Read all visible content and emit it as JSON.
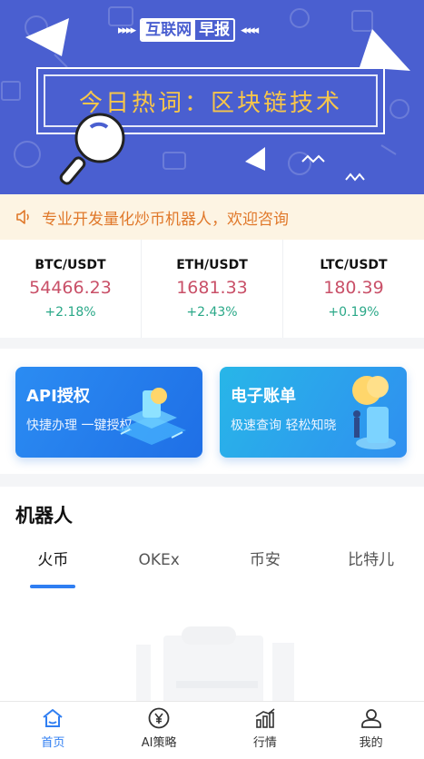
{
  "banner": {
    "brand_left": "互联网",
    "brand_right": "早报",
    "arrows_left": "▸▸▸▸",
    "arrows_right": "◂◂◂◂",
    "hotword": "今日热词：区块链技术"
  },
  "notice": {
    "text": "专业开发量化炒币机器人，欢迎咨询",
    "icon": "speaker-icon"
  },
  "tickers": [
    {
      "pair": "BTC/USDT",
      "price": "54466.23",
      "change": "+2.18%"
    },
    {
      "pair": "ETH/USDT",
      "price": "1681.33",
      "change": "+2.43%"
    },
    {
      "pair": "LTC/USDT",
      "price": "180.39",
      "change": "+0.19%"
    }
  ],
  "cards": [
    {
      "title": "API授权",
      "subtitle": "快捷办理 一键授权"
    },
    {
      "title": "电子账单",
      "subtitle": "极速查询 轻松知晓"
    }
  ],
  "robot": {
    "heading": "机器人",
    "tabs": [
      "火币",
      "OKEx",
      "币安",
      "比特儿"
    ],
    "active_tab": "火币"
  },
  "nav": [
    {
      "label": "首页",
      "icon": "home-icon"
    },
    {
      "label": "AI策略",
      "icon": "yen-icon"
    },
    {
      "label": "行情",
      "icon": "chart-icon"
    },
    {
      "label": "我的",
      "icon": "user-icon"
    }
  ],
  "colors": {
    "banner_bg": "#4a5fd0",
    "hotword": "#f7c64a",
    "notice_text": "#e0782a",
    "price": "#c95068",
    "change_up": "#2aa888",
    "accent": "#2f7ef2"
  }
}
